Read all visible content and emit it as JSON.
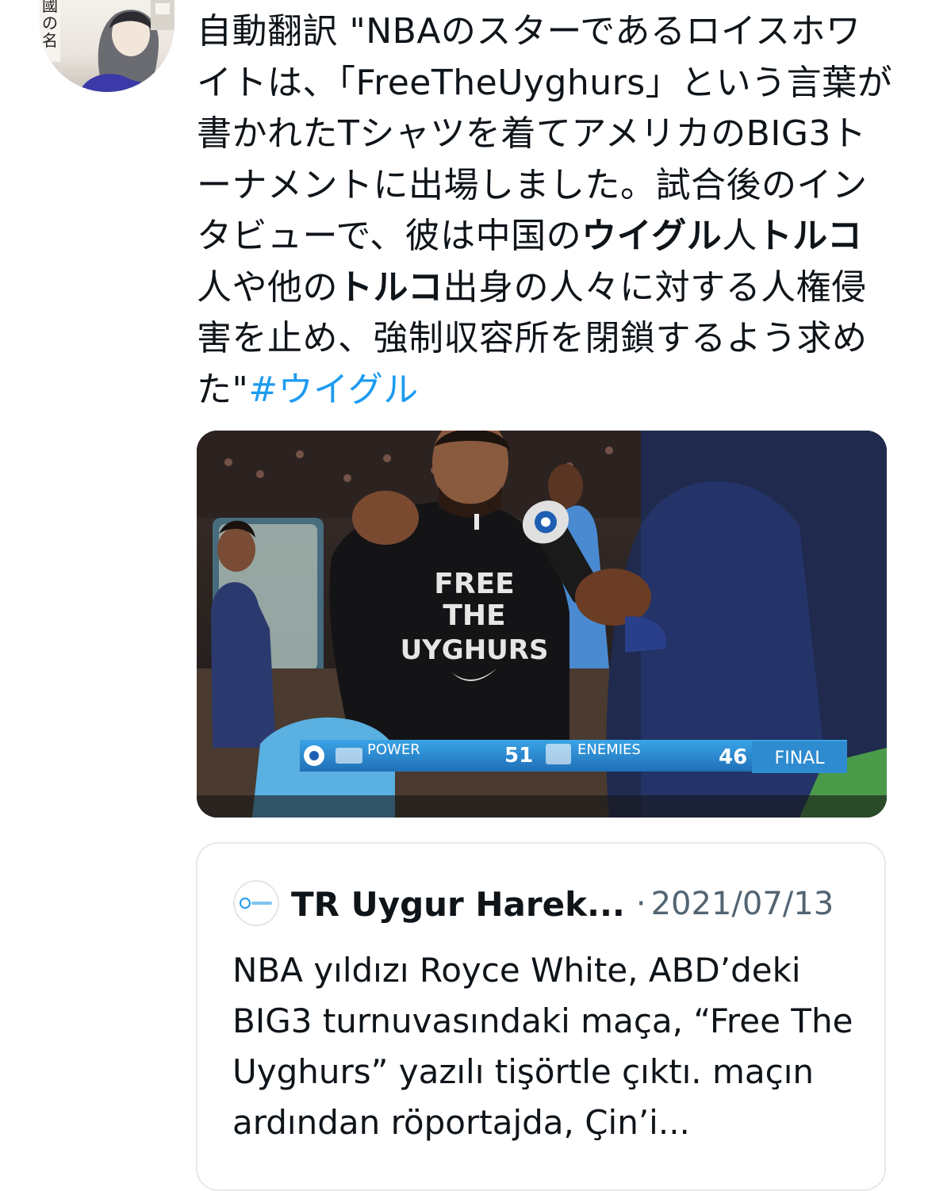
{
  "tweet": {
    "avatar_vertical_text": "國の名",
    "text_segments": [
      {
        "text": "自動翻訳 \"NBAのスターであるロイスホワイトは、「FreeTheUyghurs」という言葉が書かれたTシャツを着てアメリカのBIG3トーナメントに出場しました。試合後のインタビューで、彼は中国の",
        "style": "normal"
      },
      {
        "text": "ウイグル",
        "style": "bold"
      },
      {
        "text": "人",
        "style": "normal"
      },
      {
        "text": "トルコ",
        "style": "bold"
      },
      {
        "text": "人や他の",
        "style": "normal"
      },
      {
        "text": "トルコ",
        "style": "bold"
      },
      {
        "text": "出身の人々に対する人権侵害を止め、強制収容所を閉鎖するよう求めた\"",
        "style": "normal"
      },
      {
        "text": "#ウイグル",
        "style": "hashtag"
      }
    ],
    "hashtag_color": "#1d9bf0"
  },
  "media": {
    "shirt_lines": [
      "FREE",
      "THE",
      "UYGHURS"
    ],
    "scoreboard": {
      "home_team": "POWER",
      "home_score": "51",
      "away_team": "ENEMIES",
      "away_score": "46",
      "status": "FINAL"
    }
  },
  "quote": {
    "author": "TR Uygur Harek...",
    "separator": "·",
    "date": "2021/07/13",
    "text": "NBA yıldızı Royce White, ABD’deki BIG3 turnuvasındaki maça, “Free The Uyghurs” yazılı tişörtle çıktı. maçın ardından röportajda, Çin’i..."
  }
}
